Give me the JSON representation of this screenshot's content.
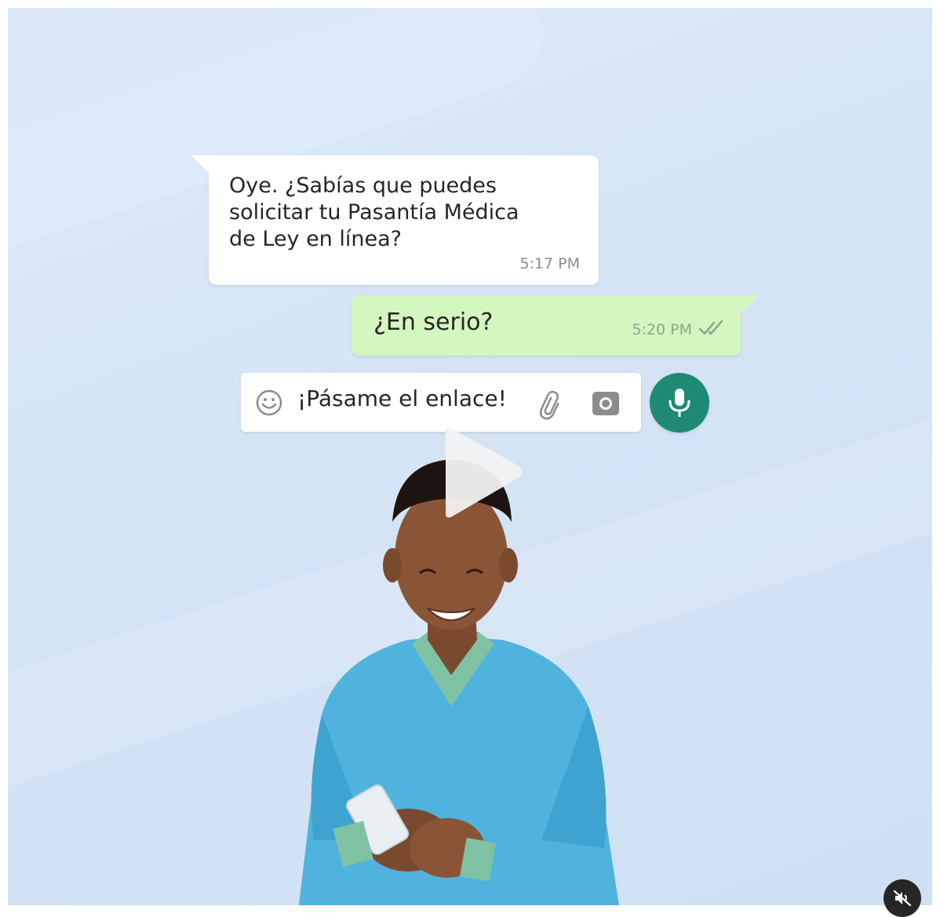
{
  "chat": {
    "incoming": {
      "text": "Oye. ¿Sabías que puedes\nsolicitar tu Pasantía Médica\nde Ley en línea?",
      "time": "5:17 PM"
    },
    "outgoing": {
      "text": "¿En serio?",
      "time": "5:20 PM",
      "status_icon": "double-check-icon"
    },
    "composer": {
      "text": "¡Pásame el enlace!",
      "icons": [
        "emoji-icon",
        "paperclip-icon",
        "camera-icon",
        "microphone-icon"
      ]
    }
  },
  "video": {
    "overlay_icon": "play-icon",
    "sound_icon": "muted-speaker-icon"
  },
  "colors": {
    "background": "#d4e4f5",
    "incoming_bubble": "#ffffff",
    "outgoing_bubble": "#d4f7c0",
    "mic_button": "#1e8a74",
    "sweater": "#4fb3de"
  }
}
